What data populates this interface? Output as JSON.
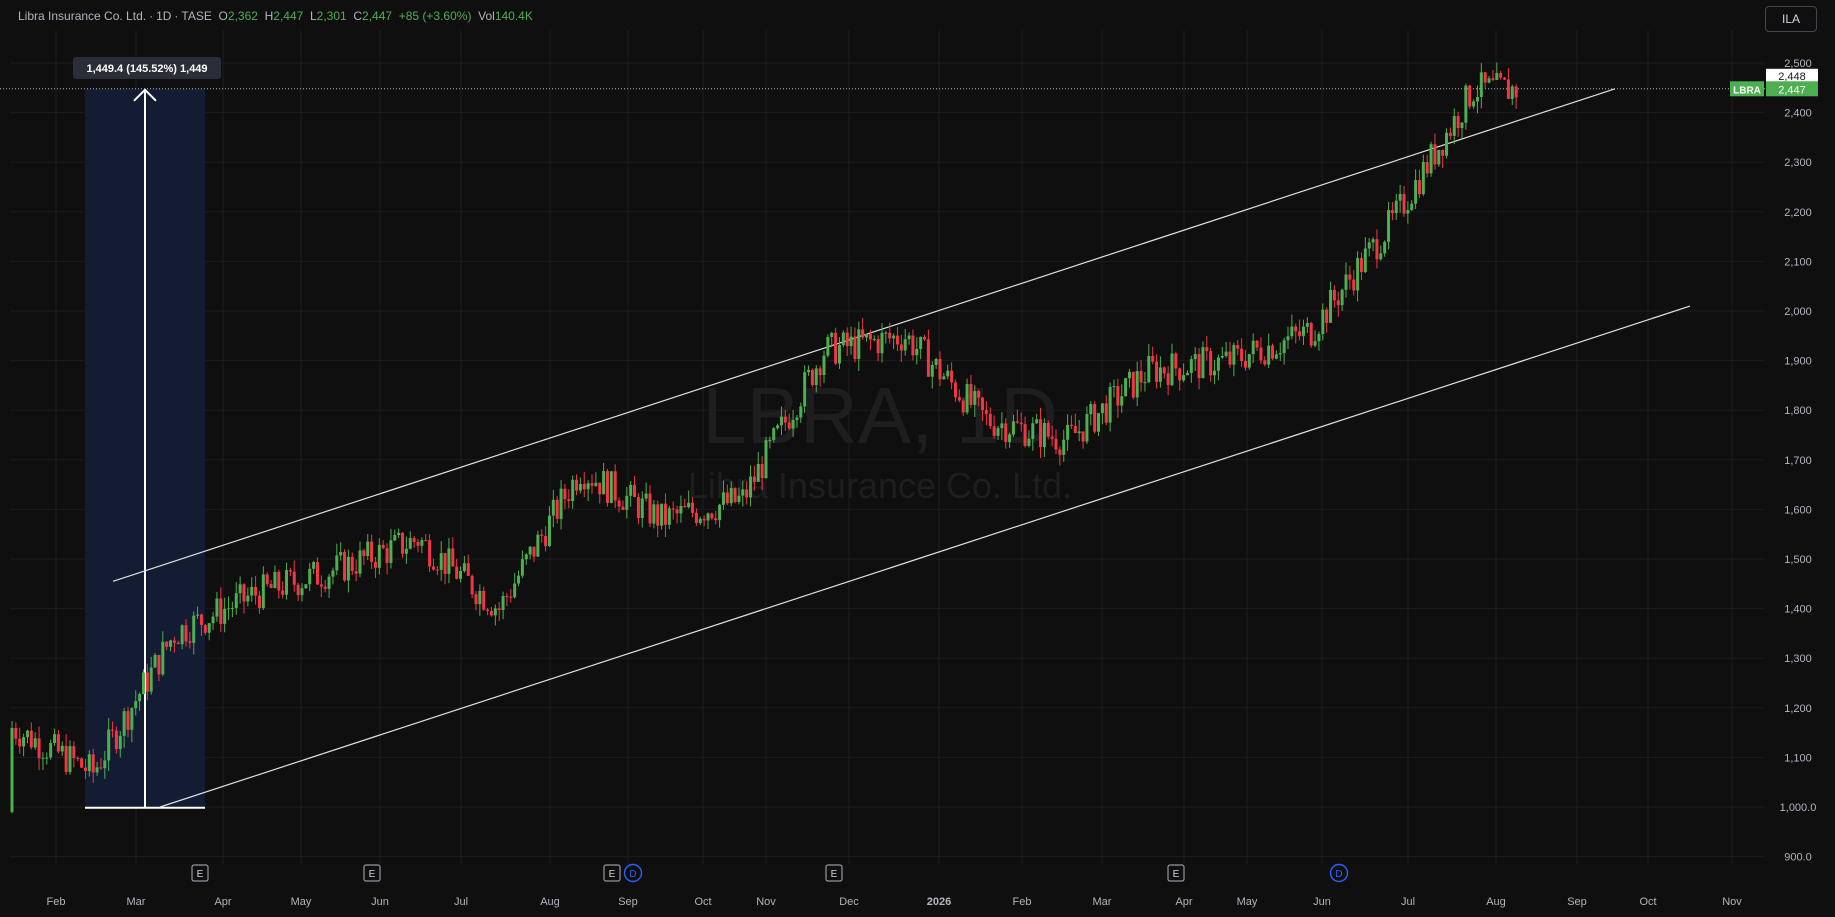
{
  "header": {
    "name": "Libra Insurance Co. Ltd.",
    "interval": "1D",
    "exchange": "TASE",
    "o_label": "O",
    "o_value": "2,362",
    "h_label": "H",
    "h_value": "2,447",
    "l_label": "L",
    "l_value": "2,301",
    "c_label": "C",
    "c_value": "2,447",
    "change": "+85 (+3.60%)",
    "vol_label": "Vol",
    "vol_value": "140.4K"
  },
  "currency_button": "ILA",
  "watermark": {
    "symbol": "LBRA, 1D",
    "name": "Libra Insurance Co. Ltd."
  },
  "measure_label": "1,449.4 (145.52%) 1,449",
  "price_badges": {
    "high_line": "2,448",
    "symbol": "LBRA",
    "last": "2,447"
  },
  "earnings_marker": "E",
  "dividend_marker": "D",
  "colors": {
    "up": "#4caf50",
    "down": "#f23645",
    "bg": "#0f0f0f",
    "grid": "#1c1c1c",
    "axis_text": "#b2b5be",
    "measure_fill": "#131c33",
    "marker_blue": "#2962ff"
  },
  "chart_data": {
    "type": "candlestick",
    "title": "Libra Insurance Co. Ltd. · 1D · TASE",
    "y_ticks": [
      "2,500",
      "2,400",
      "2,300",
      "2,200",
      "2,100",
      "2,000",
      "1,900",
      "1,800",
      "1,700",
      "1,600",
      "1,500",
      "1,400",
      "1,300",
      "1,200",
      "1,100",
      "1,000.0",
      "900.0"
    ],
    "y_tick_values": [
      2500,
      2400,
      2300,
      2200,
      2100,
      2000,
      1900,
      1800,
      1700,
      1600,
      1500,
      1400,
      1300,
      1200,
      1100,
      1000,
      900
    ],
    "ylim": [
      860,
      2555
    ],
    "x_ticks": [
      "Feb",
      "Mar",
      "Apr",
      "May",
      "Jun",
      "Jul",
      "Aug",
      "Sep",
      "Oct",
      "Nov",
      "Dec",
      "2026",
      "Feb",
      "Mar",
      "Apr",
      "May",
      "Jun",
      "Jul",
      "Aug",
      "Sep",
      "Oct",
      "Nov"
    ],
    "x_tick_index": [
      0,
      1,
      2,
      3,
      4,
      5,
      6,
      7,
      8,
      9,
      10,
      11,
      12,
      13,
      14,
      15,
      16,
      17,
      18,
      19,
      20,
      21
    ],
    "close_path_monthly": [
      {
        "month": "Feb 2025",
        "close": 1160
      },
      {
        "month": "Mar 2025",
        "close": 1070
      },
      {
        "month": "Apr 2025",
        "close": 1350
      },
      {
        "month": "May 2025",
        "close": 1430
      },
      {
        "month": "Jun 2025",
        "close": 1480
      },
      {
        "month": "Jul 2025",
        "close": 1540
      },
      {
        "month": "Aug 2025",
        "close": 1400
      },
      {
        "month": "Sep 2025",
        "close": 1680
      },
      {
        "month": "Oct 2025",
        "close": 1580
      },
      {
        "month": "Nov 2025",
        "close": 1620
      },
      {
        "month": "Dec 2025",
        "close": 1920
      },
      {
        "month": "Jan 2026",
        "close": 1950
      },
      {
        "month": "Feb 2026",
        "close": 1780
      },
      {
        "month": "Mar 2026",
        "close": 1740
      },
      {
        "month": "Apr 2026",
        "close": 1880
      },
      {
        "month": "May 2026",
        "close": 1900
      },
      {
        "month": "Jun 2026",
        "close": 1960
      },
      {
        "month": "Jul 2026",
        "close": 2180
      },
      {
        "month": "Aug 2026",
        "close": 2447
      }
    ],
    "last_price": 2447,
    "channel": {
      "upper_from": 1455,
      "upper_to": 2448,
      "lower_from": 1000,
      "lower_to": 2010
    },
    "measure": {
      "low": 998.6,
      "high": 2448,
      "change": 1449.4,
      "percent": 145.52
    },
    "earnings_marker_months": [
      "Apr 2025",
      "Jun 2025",
      "Sep 2025",
      "Dec 2025",
      "Apr 2026"
    ],
    "dividend_marker_months": [
      "Sep 2025",
      "Jun 2026"
    ]
  }
}
